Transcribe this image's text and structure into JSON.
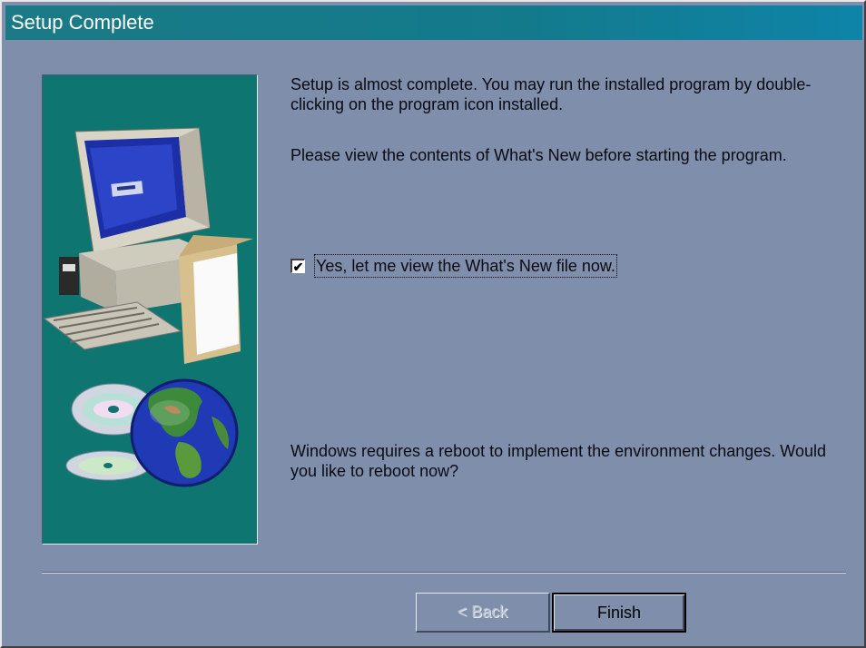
{
  "window": {
    "title": "Setup Complete"
  },
  "content": {
    "paragraph1": "Setup is almost complete.  You may run the installed program by double-clicking on the program icon installed.",
    "paragraph2": "Please view the contents of What's New before starting the program.",
    "checkbox": {
      "label": "Yes, let me view the What's New file now.",
      "checked": true
    },
    "paragraph3": "Windows requires a reboot to implement the environment changes. Would you like to reboot now?"
  },
  "buttons": {
    "back_label": "< Back",
    "back_enabled": false,
    "finish_label": "Finish"
  },
  "icons": {
    "side_image": [
      "computer-icon",
      "cd-icon",
      "globe-icon"
    ]
  }
}
